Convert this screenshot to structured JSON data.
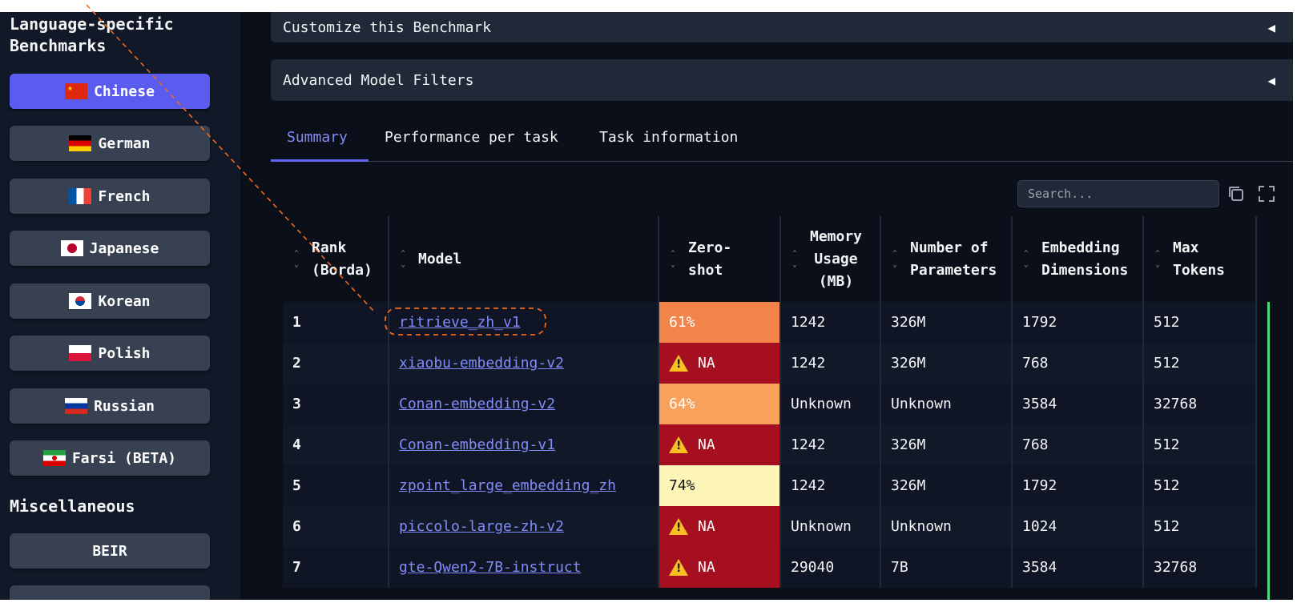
{
  "sidebar": {
    "heading": "Language-specific\nBenchmarks",
    "heading_line1": "Language-specific",
    "heading_line2": "Benchmarks",
    "items": [
      {
        "label": "Chinese",
        "flag": "flag-cn",
        "active": true
      },
      {
        "label": "German",
        "flag": "flag-de"
      },
      {
        "label": "French",
        "flag": "flag-fr"
      },
      {
        "label": "Japanese",
        "flag": "flag-jp"
      },
      {
        "label": "Korean",
        "flag": "flag-kr"
      },
      {
        "label": "Polish",
        "flag": "flag-pl"
      },
      {
        "label": "Russian",
        "flag": "flag-ru"
      },
      {
        "label": "Farsi (BETA)",
        "flag": "flag-ir"
      }
    ],
    "misc_heading": "Miscellaneous",
    "misc_items": [
      {
        "label": "BEIR"
      }
    ]
  },
  "accordions": {
    "customize": "Customize this Benchmark",
    "advanced": "Advanced Model Filters"
  },
  "tabs": [
    {
      "label": "Summary",
      "active": true
    },
    {
      "label": "Performance per task"
    },
    {
      "label": "Task information"
    }
  ],
  "search": {
    "placeholder": "Search..."
  },
  "table": {
    "columns": [
      {
        "line1": "Rank",
        "line2": "(Borda)"
      },
      {
        "line1": "Model"
      },
      {
        "line1": "Zero-",
        "line2": "shot"
      },
      {
        "line1": "Memory",
        "line2": "Usage",
        "line3": "(MB)"
      },
      {
        "line1": "Number of",
        "line2": "Parameters"
      },
      {
        "line1": "Embedding",
        "line2": "Dimensions"
      },
      {
        "line1": "Max",
        "line2": "Tokens"
      }
    ],
    "rows": [
      {
        "rank": "1",
        "model": "ritrieve_zh_v1",
        "zero_shot": "61%",
        "zs_color": "#f3844a",
        "memory": "1242",
        "params": "326M",
        "dims": "1792",
        "tokens": "512"
      },
      {
        "rank": "2",
        "model": "xiaobu-embedding-v2",
        "zero_shot": "NA",
        "zs_color": "#a50f1f",
        "warn": true,
        "memory": "1242",
        "params": "326M",
        "dims": "768",
        "tokens": "512"
      },
      {
        "rank": "3",
        "model": "Conan-embedding-v2",
        "zero_shot": "64%",
        "zs_color": "#f8a15a",
        "memory": "Unknown",
        "params": "Unknown",
        "dims": "3584",
        "tokens": "32768"
      },
      {
        "rank": "4",
        "model": "Conan-embedding-v1",
        "zero_shot": "NA",
        "zs_color": "#a50f1f",
        "warn": true,
        "memory": "1242",
        "params": "326M",
        "dims": "768",
        "tokens": "512"
      },
      {
        "rank": "5",
        "model": "zpoint_large_embedding_zh",
        "zero_shot": "74%",
        "zs_color": "#fdf5b7",
        "zs_text": "#111111",
        "memory": "1242",
        "params": "326M",
        "dims": "1792",
        "tokens": "512"
      },
      {
        "rank": "6",
        "model": "piccolo-large-zh-v2",
        "zero_shot": "NA",
        "zs_color": "#a50f1f",
        "warn": true,
        "memory": "Unknown",
        "params": "Unknown",
        "dims": "1024",
        "tokens": "512"
      },
      {
        "rank": "7",
        "model": "gte-Qwen2-7B-instruct",
        "zero_shot": "NA",
        "zs_color": "#a50f1f",
        "warn": true,
        "memory": "29040",
        "params": "7B",
        "dims": "3584",
        "tokens": "32768"
      }
    ]
  },
  "colors": {
    "accent": "#6366f1",
    "annotation": "#f06a1c",
    "link": "#818cf8",
    "stripe": "#4ade80"
  },
  "icons": [
    "copy-icon",
    "fullscreen-icon",
    "sort-icon",
    "warning-icon"
  ]
}
